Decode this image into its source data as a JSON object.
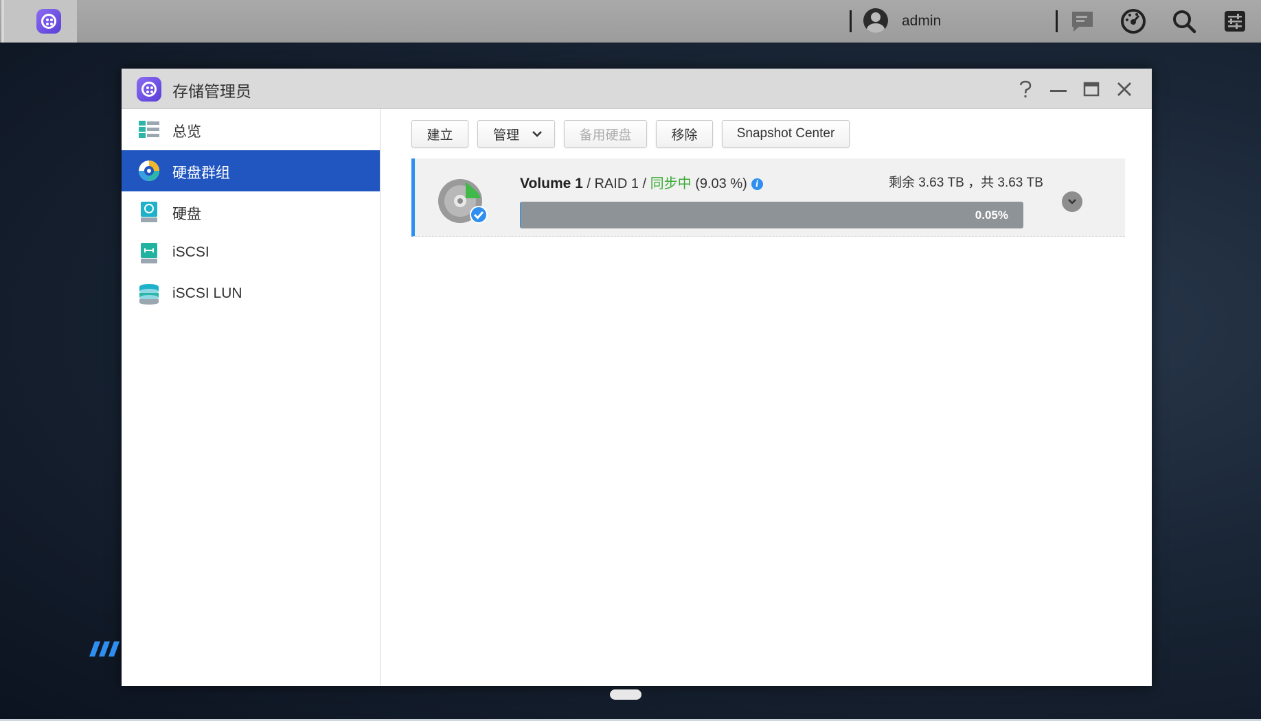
{
  "taskbar": {
    "app_icon": "storage-manager-icon",
    "username": "admin",
    "icons": [
      "user-icon",
      "notification-icon",
      "dashboard-icon",
      "search-icon",
      "settings-icon"
    ]
  },
  "window": {
    "title": "存储管理员",
    "controls": [
      "help-icon",
      "minimize-icon",
      "maximize-icon",
      "close-icon"
    ]
  },
  "sidebar": {
    "items": [
      {
        "label": "总览",
        "icon": "overview-icon",
        "active": false
      },
      {
        "label": "硬盘群组",
        "icon": "disk-group-icon",
        "active": true
      },
      {
        "label": "硬盘",
        "icon": "disk-icon",
        "active": false
      },
      {
        "label": "iSCSI",
        "icon": "iscsi-icon",
        "active": false
      },
      {
        "label": "iSCSI LUN",
        "icon": "iscsi-lun-icon",
        "active": false
      }
    ]
  },
  "toolbar": {
    "create_label": "建立",
    "manage_label": "管理",
    "hot_spare_label": "备用硬盘",
    "remove_label": "移除",
    "snapshot_label": "Snapshot Center"
  },
  "volume": {
    "name": "Volume 1",
    "sep1": " / ",
    "raid": "RAID 1",
    "sep2": " / ",
    "status": "同步中",
    "sync_percent": "(9.03 %)",
    "free": "剩余 3.63 TB",
    "total": "，共 3.63 TB",
    "usage_text": "0.05%",
    "usage_value": 0.0005
  },
  "colors": {
    "accent": "#2156c0",
    "sync_green": "#3aaa35",
    "info_blue": "#2f8ff0",
    "progress_track": "#8e9397"
  }
}
